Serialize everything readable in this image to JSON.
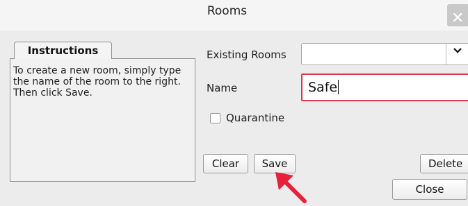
{
  "window": {
    "title": "Rooms",
    "close_glyph": "✕",
    "close_icon": "close-icon"
  },
  "instructions": {
    "tab_label": "Instructions",
    "text": "To create a new room, simply type the name of the room to the right. Then click Save."
  },
  "form": {
    "existing_rooms_label": "Existing Rooms",
    "existing_rooms_value": "",
    "chevron_glyph": "⌄",
    "name_label": "Name",
    "name_value": "Safe",
    "quarantine_label": "Quarantine",
    "quarantine_checked": false
  },
  "buttons": {
    "clear": "Clear",
    "save": "Save",
    "delete": "Delete",
    "close": "Close"
  },
  "annotation": {
    "arrow_color": "#e8203a",
    "highlight_color": "#e03550"
  }
}
